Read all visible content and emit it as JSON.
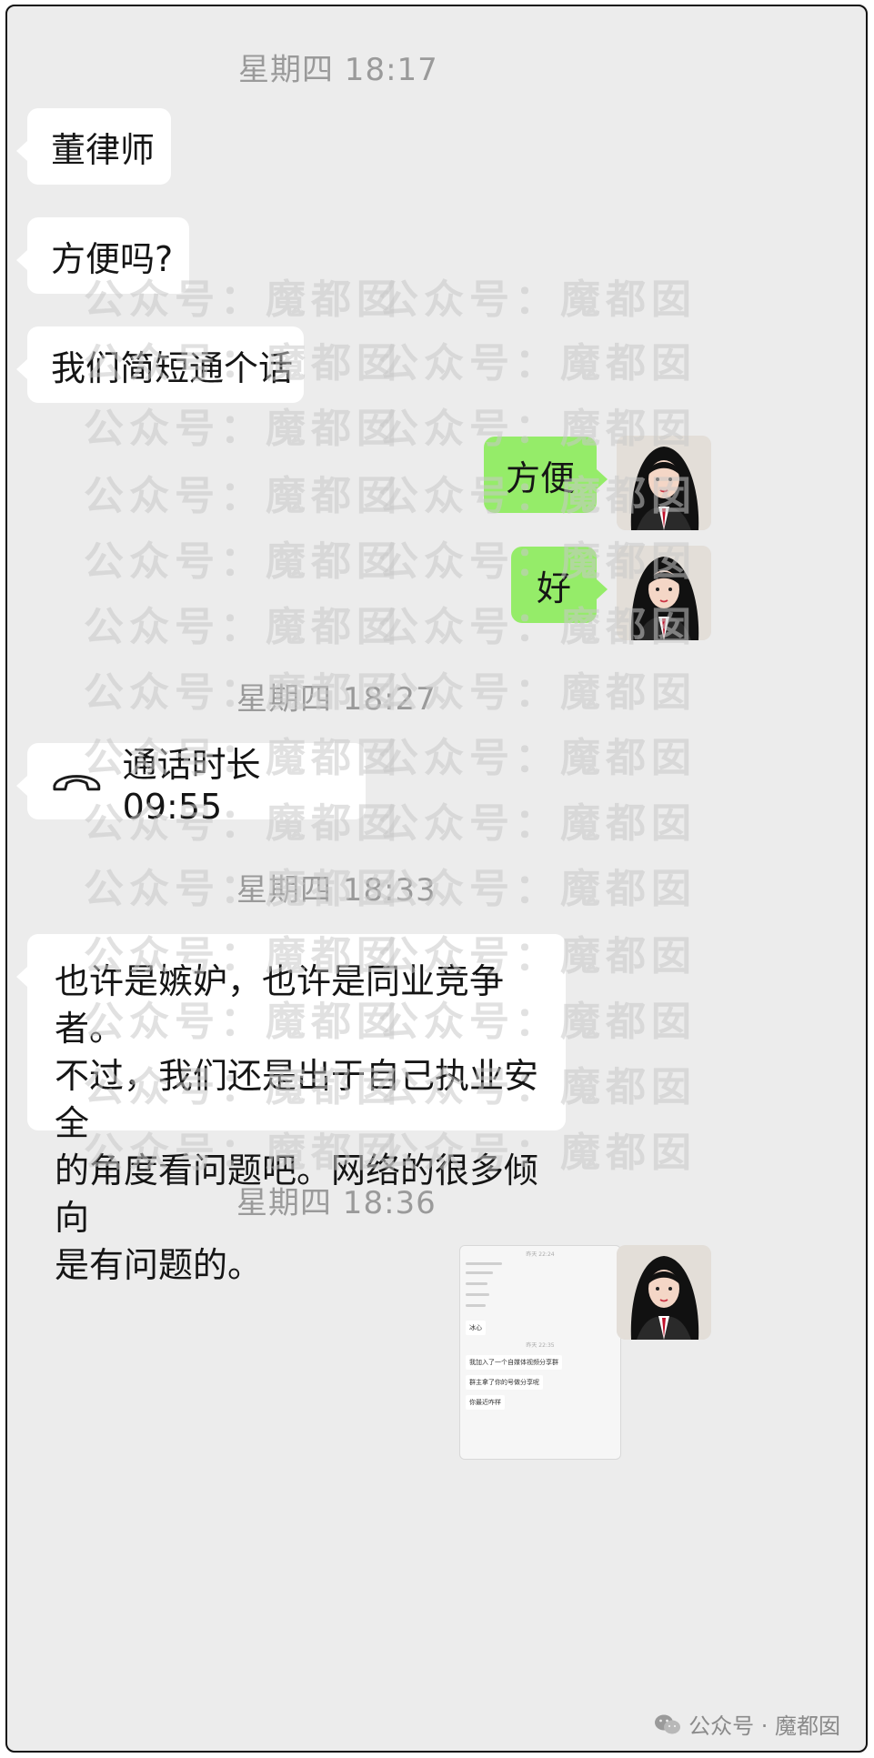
{
  "timestamps": [
    "星期四 18:17",
    "星期四 18:27",
    "星期四 18:33",
    "星期四 18:36"
  ],
  "messages": {
    "m1": "董律师",
    "m2": "方便吗?",
    "m3": "我们简短通个话",
    "reply1": "方便",
    "reply2": "好",
    "call_label": "通话时长 09:55",
    "long_lines": [
      "也许是嫉妒，也许是同业竞争者。",
      "不过，我们还是出于自己执业安全",
      "的角度看问题吧。网络的很多倾向",
      "是有问题的。"
    ]
  },
  "thumbnail": {
    "time_top": "昨天 22:24",
    "bubble1": "冰心",
    "time_mid": "昨天 22:35",
    "bubble2": "我加入了一个自媒体视频分享群",
    "bubble3": "群主拿了你的号做分享呢",
    "bubble4": "你最近咋样"
  },
  "watermark": "公众号：魔都囡",
  "footer": "公众号 · 魔都囡",
  "colors": {
    "outgoing_bubble": "#95ec69",
    "incoming_bubble": "#ffffff",
    "background": "#ececec"
  },
  "icons": [
    "phone-hangup-icon",
    "wechat-icon"
  ]
}
